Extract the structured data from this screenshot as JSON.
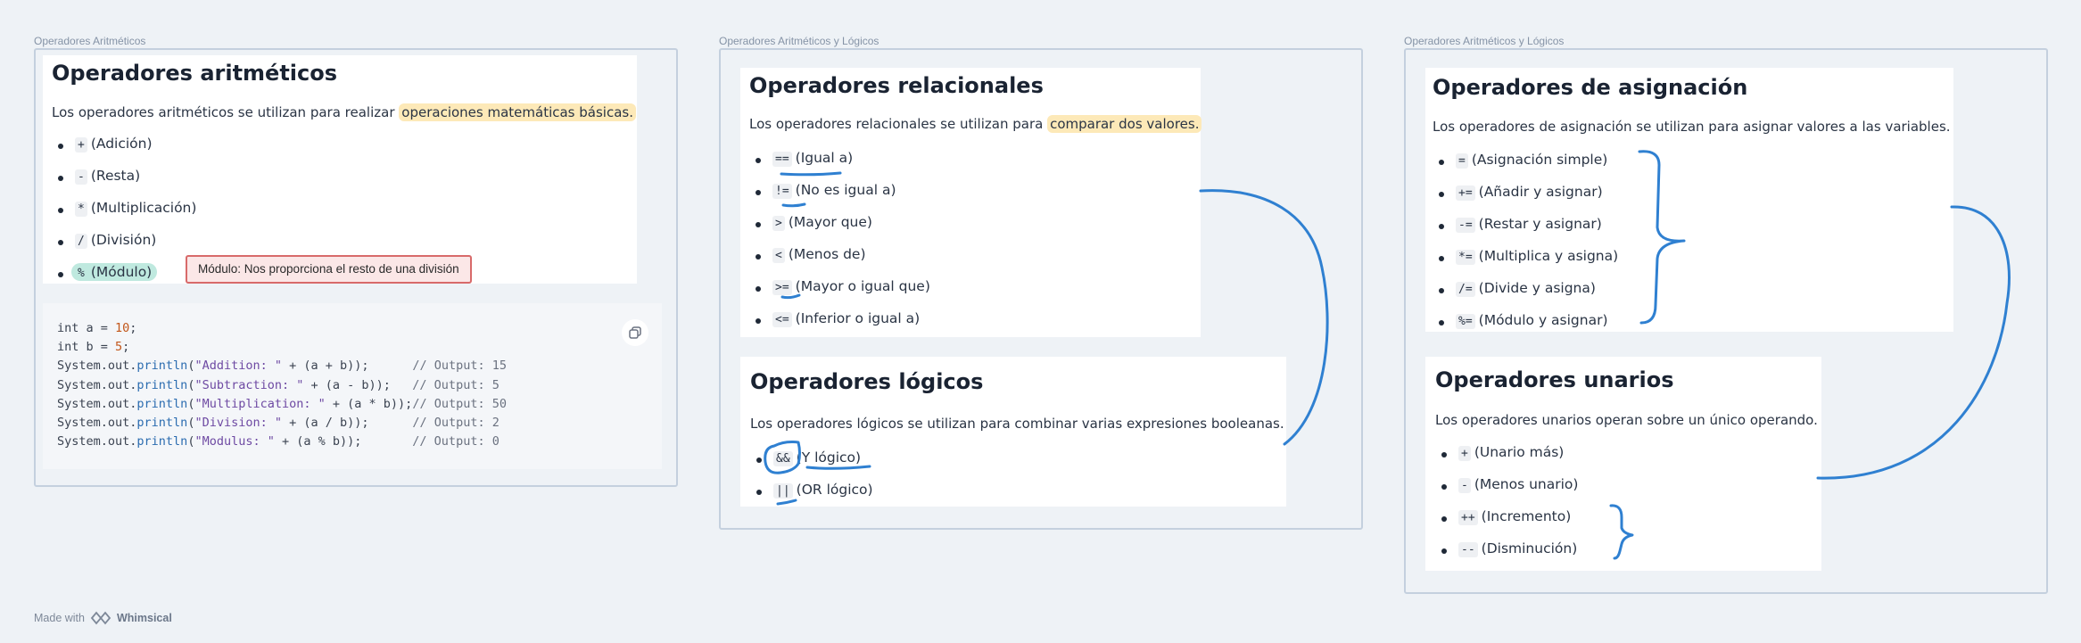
{
  "frames": {
    "f1_title": "Operadores Aritméticos",
    "f2_title": "Operadores Aritméticos y Lógicos",
    "f3_title": "Operadores Aritméticos y Lógicos"
  },
  "arith": {
    "title": "Operadores aritméticos",
    "desc_pre": "Los operadores aritméticos se utilizan para realizar ",
    "desc_hl": "operaciones matemáticas básicas.",
    "items": [
      {
        "op": "+",
        "label": "(Adición)"
      },
      {
        "op": "-",
        "label": "(Resta)"
      },
      {
        "op": "*",
        "label": "(Multiplicación)"
      },
      {
        "op": "/",
        "label": "(División)"
      },
      {
        "op": "%",
        "label": "(Módulo)"
      }
    ],
    "tooltip": "Módulo: Nos proporciona el resto de una división"
  },
  "code_lines": [
    "int a = 10;",
    "int b = 5;",
    "System.out.println(\"Addition: \" + (a + b));      // Output: 15",
    "System.out.println(\"Subtraction: \" + (a - b));   // Output: 5",
    "System.out.println(\"Multiplication: \" + (a * b));// Output: 50",
    "System.out.println(\"Division: \" + (a / b));      // Output: 2",
    "System.out.println(\"Modulus: \" + (a % b));       // Output: 0"
  ],
  "relational": {
    "title": "Operadores relacionales",
    "desc_pre": "Los operadores relacionales se utilizan para ",
    "desc_hl": "comparar dos valores.",
    "items": [
      {
        "op": "==",
        "label": "(Igual a)"
      },
      {
        "op": "!=",
        "label": "(No es igual a)"
      },
      {
        "op": ">",
        "label": "(Mayor que)"
      },
      {
        "op": "<",
        "label": "(Menos de)"
      },
      {
        "op": ">=",
        "label": "(Mayor o igual que)"
      },
      {
        "op": "<=",
        "label": "(Inferior o igual a)"
      }
    ]
  },
  "logical": {
    "title": "Operadores lógicos",
    "desc": "Los operadores lógicos se utilizan para combinar varias expresiones booleanas.",
    "items": [
      {
        "op": "&&",
        "label": "(Y lógico)"
      },
      {
        "op": "||",
        "label": "(OR lógico)"
      }
    ]
  },
  "assignment": {
    "title": "Operadores de asignación",
    "desc": "Los operadores de asignación se utilizan para asignar valores a las variables.",
    "items": [
      {
        "op": "=",
        "label": "(Asignación simple)"
      },
      {
        "op": "+=",
        "label": "(Añadir y asignar)"
      },
      {
        "op": "-=",
        "label": "(Restar y asignar)"
      },
      {
        "op": "*=",
        "label": "(Multiplica y asigna)"
      },
      {
        "op": "/=",
        "label": "(Divide y asigna)"
      },
      {
        "op": "%=",
        "label": "(Módulo y asignar)"
      }
    ]
  },
  "unary": {
    "title": "Operadores unarios",
    "desc": "Los operadores unarios operan sobre un único operando.",
    "items": [
      {
        "op": "+",
        "label": "(Unario más)"
      },
      {
        "op": "-",
        "label": "(Menos unario)"
      },
      {
        "op": "++",
        "label": "(Incremento)"
      },
      {
        "op": "--",
        "label": "(Disminución)"
      }
    ]
  },
  "footer": {
    "made_with": "Made with",
    "brand": "Whimsical"
  },
  "colors": {
    "annotation": "#2f80d1",
    "highlight": "#fde9b8",
    "teal": "#bfe9df"
  },
  "icons": {
    "copy": "copy-icon",
    "logo": "whimsical-logo-icon"
  }
}
